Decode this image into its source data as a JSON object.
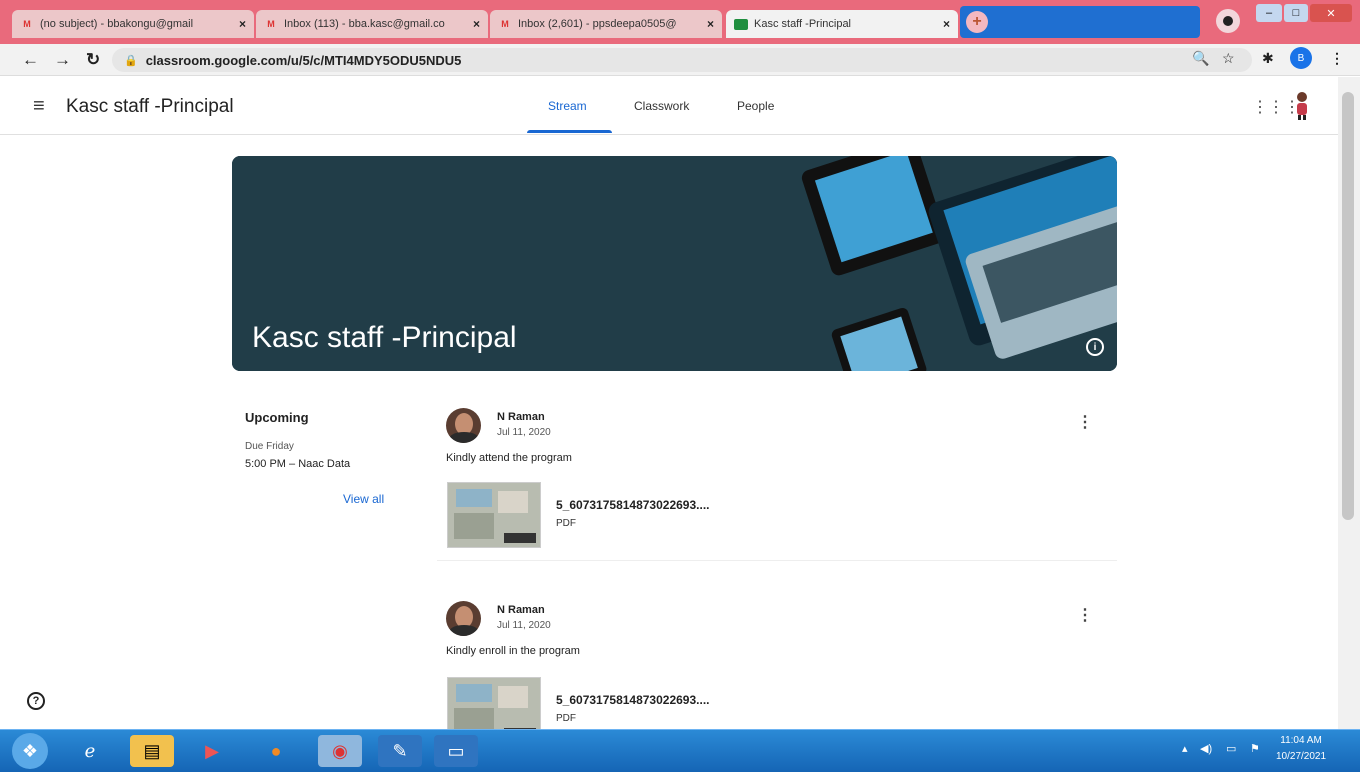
{
  "browser": {
    "tabs": [
      {
        "icon": "gmail-icon",
        "label": "(no subject) - bbakongu@gmail",
        "active": false
      },
      {
        "icon": "gmail-icon",
        "label": "Inbox (113) - bba.kasc@gmail.co",
        "active": false
      },
      {
        "icon": "gmail-icon",
        "label": "Inbox (2,601) - ppsdeepa0505@",
        "active": false
      },
      {
        "icon": "classroom-icon",
        "label": "Kasc staff -Principal",
        "active": true
      }
    ],
    "close_glyph": "×",
    "newtab_glyph": "+",
    "url": "classroom.google.com/u/5/c/MTI4MDY5ODU5NDU5",
    "profile_initial": "B"
  },
  "classroom": {
    "menu_glyph": "≡",
    "title": "Kasc staff -Principal",
    "tabs": {
      "stream": "Stream",
      "classwork": "Classwork",
      "people": "People"
    }
  },
  "banner": {
    "title": "Kasc staff -Principal",
    "info_glyph": "i"
  },
  "upcoming": {
    "heading": "Upcoming",
    "due": "Due Friday",
    "item": "5:00 PM – Naac Data",
    "view_all": "View all"
  },
  "posts": [
    {
      "author": "N Raman",
      "date": "Jul 11, 2020",
      "text": "Kindly attend the program",
      "attachment": {
        "name": "5_6073175814873022693....",
        "type": "PDF"
      }
    },
    {
      "author": "N Raman",
      "date": "Jul 11, 2020",
      "text": "Kindly enroll in the program",
      "attachment": {
        "name": "5_6073175814873022693....",
        "type": "PDF"
      }
    }
  ],
  "help_glyph": "?",
  "taskbar": {
    "time": "11:04 AM",
    "date": "10/27/2021"
  },
  "colors": {
    "accent": "#1967d2",
    "banner": "#213d48",
    "tabbar": "#e96a7c"
  }
}
